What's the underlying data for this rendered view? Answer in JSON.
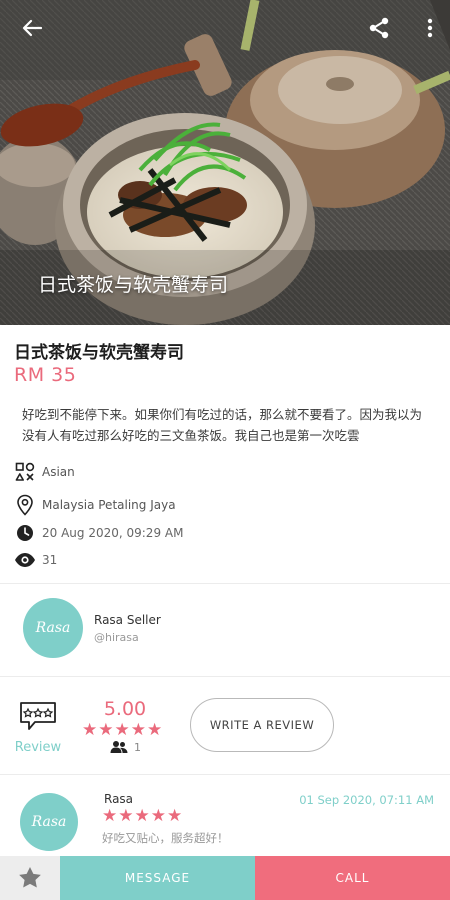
{
  "hero": {
    "caption": "日式茶饭与软壳蟹寿司",
    "icons": {
      "back": "arrow-left-icon",
      "share": "share-icon",
      "more": "more-vertical-icon"
    }
  },
  "listing": {
    "title": "日式茶饭与软壳蟹寿司",
    "price": "RM 35",
    "description": "好吃到不能停下来。如果你们有吃过的话，那么就不要看了。因为我以为没有人有吃过那么好吃的三文鱼茶饭。我自己也是第一次吃雲",
    "category": "Asian",
    "location": "Malaysia Petaling Jaya",
    "posted": "20 Aug 2020, 09:29 AM",
    "views": "31"
  },
  "seller": {
    "avatar_text": "Rasa",
    "name": "Rasa Seller",
    "handle": "@hirasa"
  },
  "rating": {
    "review_label": "Review",
    "score": "5.00",
    "stars": 5,
    "count": "1",
    "write_review_label": "WRITE A REVIEW"
  },
  "review": {
    "avatar_text": "Rasa",
    "name": "Rasa",
    "date": "01 Sep 2020, 07:11 AM",
    "stars": 5,
    "text": "好吃又贴心，服务超好！"
  },
  "bottom_bar": {
    "message_label": "MESSAGE",
    "call_label": "CALL"
  },
  "colors": {
    "accent_teal": "#7fcfc9",
    "accent_pink": "#ea6a7c",
    "call_pink": "#f06d7d"
  }
}
